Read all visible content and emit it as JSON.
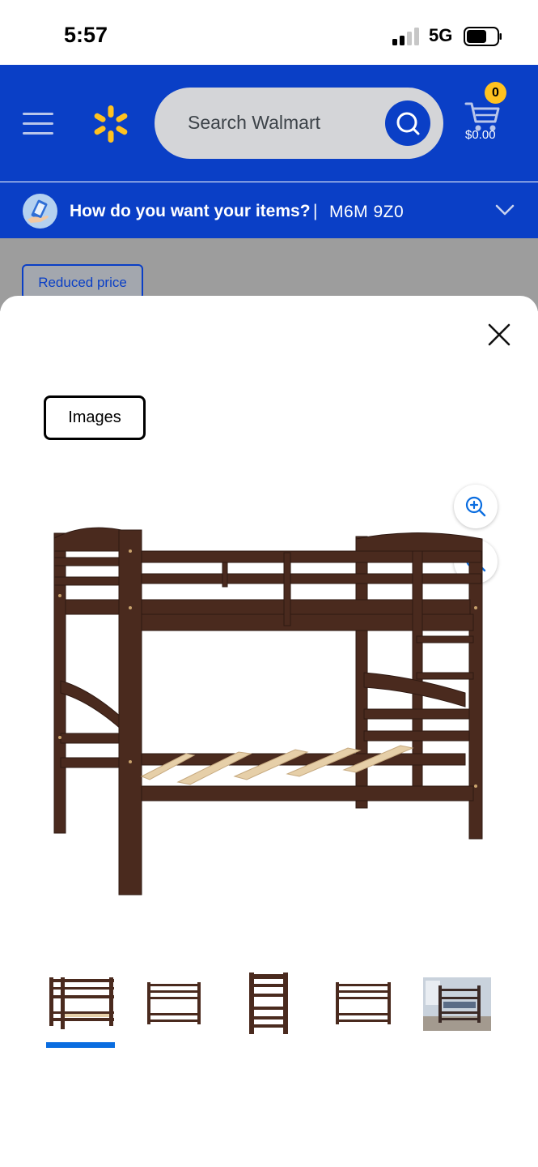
{
  "status_bar": {
    "time": "5:57",
    "network": "5G"
  },
  "header": {
    "search_placeholder": "Search Walmart",
    "cart_count": "0",
    "cart_total": "$0.00"
  },
  "delivery": {
    "question": "How do you want your items?",
    "separator": "|",
    "postal_code": "M6M 9Z0"
  },
  "background": {
    "badge": "Reduced price"
  },
  "modal": {
    "tab_label": "Images",
    "thumbnails": [
      "thumbnail-1",
      "thumbnail-2",
      "thumbnail-3",
      "thumbnail-4",
      "thumbnail-5"
    ],
    "selected_thumbnail": 0
  },
  "colors": {
    "brand_blue": "#0a3fc6",
    "spark_yellow": "#ffc220",
    "accent_blue": "#0a6de0",
    "wood": "#4a2a1e"
  },
  "icons": [
    "menu-icon",
    "spark-logo-icon",
    "search-icon",
    "cart-icon",
    "delivery-icon",
    "chevron-down-icon",
    "close-icon",
    "zoom-in-icon",
    "zoom-out-icon"
  ]
}
